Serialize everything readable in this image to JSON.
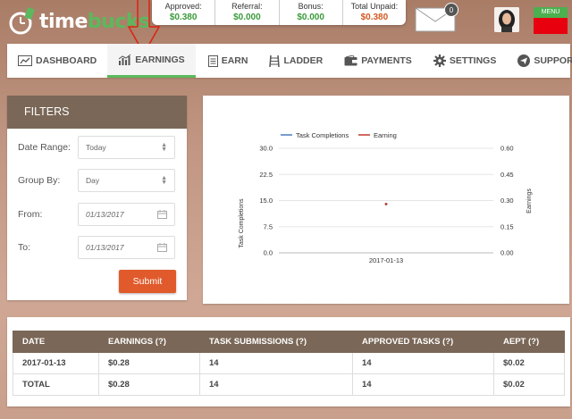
{
  "brand": {
    "name_part1": "time",
    "name_part2": "bucks"
  },
  "stats": [
    {
      "label": "Approved:",
      "value": "$0.380",
      "color": "#3a9a3a"
    },
    {
      "label": "Referral:",
      "value": "$0.000",
      "color": "#3a9a3a"
    },
    {
      "label": "Bonus:",
      "value": "$0.000",
      "color": "#3a9a3a"
    },
    {
      "label": "Total Unpaid:",
      "value": "$0.380",
      "color": "#d2591f"
    }
  ],
  "mail": {
    "count": "0",
    "icon": "envelope-icon"
  },
  "menu": {
    "label": "MENU"
  },
  "nav": [
    {
      "label": "DASHBOARD",
      "icon": "dashboard-icon",
      "active": false
    },
    {
      "label": "EARNINGS",
      "icon": "bar-chart-icon",
      "active": true
    },
    {
      "label": "EARN",
      "icon": "document-icon",
      "active": false
    },
    {
      "label": "LADDER",
      "icon": "ladder-icon",
      "active": false
    },
    {
      "label": "PAYMENTS",
      "icon": "wallet-icon",
      "active": false
    },
    {
      "label": "SETTINGS",
      "icon": "gear-icon",
      "active": false
    },
    {
      "label": "SUPPORT",
      "icon": "send-icon",
      "active": false
    }
  ],
  "filters": {
    "title": "FILTERS",
    "date_range_label": "Date Range:",
    "date_range_value": "Today",
    "group_by_label": "Group By:",
    "group_by_value": "Day",
    "from_label": "From:",
    "from_value": "01/13/2017",
    "to_label": "To:",
    "to_value": "01/13/2017",
    "submit_label": "Submit"
  },
  "chart_data": {
    "type": "line",
    "x": [
      "2017-01-13"
    ],
    "series": [
      {
        "name": "Task Completions",
        "axis": "left",
        "color": "#4a7bbf",
        "values": [
          14
        ]
      },
      {
        "name": "Earning",
        "axis": "right",
        "color": "#c0392b",
        "values": [
          0.28
        ]
      }
    ],
    "ylabel": "Task Completions",
    "y2label": "Earnings",
    "ylim": [
      0,
      30
    ],
    "y2lim": [
      0,
      0.6
    ],
    "yticks": [
      "30.0",
      "22.5",
      "15.0",
      "7.5",
      "0.0"
    ],
    "y2ticks": [
      "0.60",
      "0.45",
      "0.30",
      "0.15",
      "0.00"
    ],
    "legend": "top-left",
    "grid": true
  },
  "table": {
    "headers": [
      "DATE",
      "EARNINGS (?)",
      "TASK SUBMISSIONS (?)",
      "APPROVED TASKS (?)",
      "AEPT (?)"
    ],
    "rows": [
      [
        "2017-01-13",
        "$0.28",
        "14",
        "14",
        "$0.02"
      ],
      [
        "TOTAL",
        "$0.28",
        "14",
        "14",
        "$0.02"
      ]
    ]
  }
}
